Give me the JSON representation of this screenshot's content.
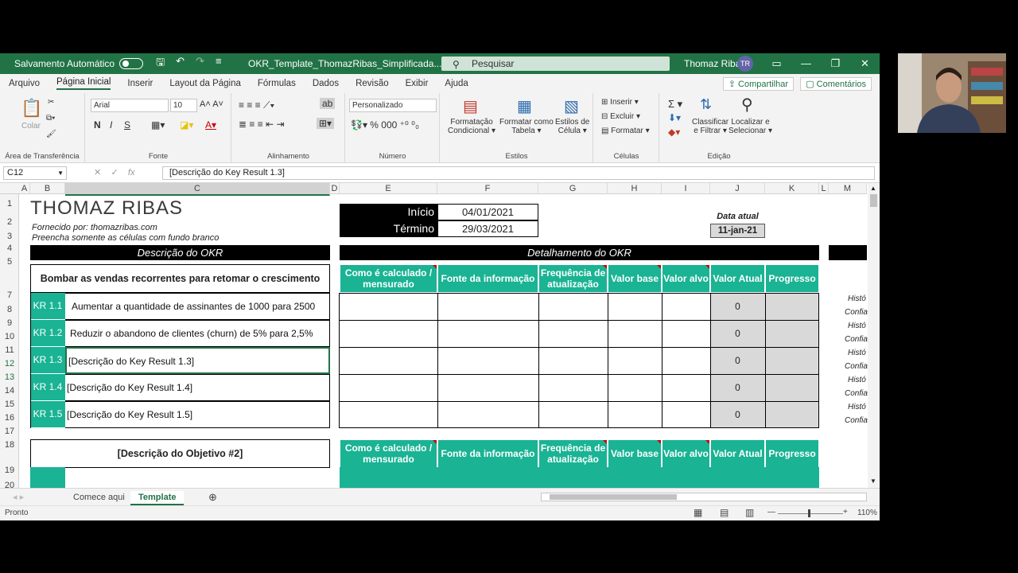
{
  "titlebar": {
    "autosave": "Salvamento Automático",
    "filename": "OKR_Template_ThomazRibas_Simplificada...",
    "search": "Pesquisar",
    "user": "Thomaz Ribas",
    "initials": "TR"
  },
  "tabs": [
    "Arquivo",
    "Página Inicial",
    "Inserir",
    "Layout da Página",
    "Fórmulas",
    "Dados",
    "Revisão",
    "Exibir",
    "Ajuda"
  ],
  "share": "Compartilhar",
  "comments": "Comentários",
  "ribbon": {
    "paste": "Colar",
    "clipboard": "Área de Transferência",
    "font_name": "Arial",
    "font_size": "10",
    "font_group": "Fonte",
    "align_group": "Alinhamento",
    "number_format": "Personalizado",
    "number_group": "Número",
    "cond_format_1": "Formatação",
    "cond_format_2": "Condicional",
    "format_table_1": "Formatar como",
    "format_table_2": "Tabela",
    "cell_styles_1": "Estilos de",
    "cell_styles_2": "Célula",
    "styles_group": "Estilos",
    "insert": "Inserir",
    "delete": "Excluir",
    "format": "Formatar",
    "cells_group": "Células",
    "sort_1": "Classificar",
    "sort_2": "e Filtrar",
    "find_1": "Localizar e",
    "find_2": "Selecionar",
    "edit_group": "Edição",
    "bold": "N",
    "italic": "I",
    "underline": "S"
  },
  "formula": {
    "namebox": "C12",
    "content": "[Descrição do Key Result 1.3]"
  },
  "columns": [
    "A",
    "B",
    "C",
    "D",
    "E",
    "F",
    "G",
    "H",
    "I",
    "J",
    "K",
    "L",
    "M"
  ],
  "rows": [
    "1",
    "2",
    "3",
    "4",
    "5",
    "7",
    "8",
    "9",
    "10",
    "11",
    "12",
    "13",
    "14",
    "15",
    "16",
    "17",
    "18",
    "19",
    "20"
  ],
  "sheet": {
    "logo": "THOMAZ RIBAS",
    "provided": "Fornecido por: thomazribas.com",
    "fill_note": "Preencha somente as células com fundo branco",
    "start_label": "Início",
    "start_date": "04/01/2021",
    "end_label": "Término",
    "end_date": "29/03/2021",
    "current_label": "Data atual",
    "current_date": "11-jan-21",
    "okr_desc": "Descrição do OKR",
    "okr_detail": "Detalhamento do OKR",
    "objective1": "Bombar as vendas recorrentes para retomar o crescimento",
    "objective2": "[Descrição do Objetivo #2]",
    "headers": [
      "Como é calculado / mensurado",
      "Fonte da informação",
      "Frequência de atualização",
      "Valor base",
      "Valor alvo",
      "Valor Atual",
      "Progresso"
    ],
    "krs": [
      {
        "id": "KR 1.1",
        "text": "Aumentar a quantidade de assinantes de 1000 para 2500",
        "value": "0",
        "m1": "Histó",
        "m2": "Confia"
      },
      {
        "id": "KR 1.2",
        "text": "Reduzir o abandono de clientes (churn) de 5% para 2,5%",
        "value": "0",
        "m1": "Histó",
        "m2": "Confia"
      },
      {
        "id": "KR 1.3",
        "text": "[Descrição do Key Result 1.3]",
        "value": "0",
        "m1": "Histó",
        "m2": "Confia"
      },
      {
        "id": "KR 1.4",
        "text": "[Descrição do Key Result 1.4]",
        "value": "0",
        "m1": "Histó",
        "m2": "Confia"
      },
      {
        "id": "KR 1.5",
        "text": "[Descrição do Key Result 1.5]",
        "value": "0",
        "m1": "Histó",
        "m2": "Confia"
      }
    ]
  },
  "sheettabs": [
    "Comece aqui",
    "Template"
  ],
  "status": {
    "ready": "Pronto",
    "zoom": "110%"
  }
}
